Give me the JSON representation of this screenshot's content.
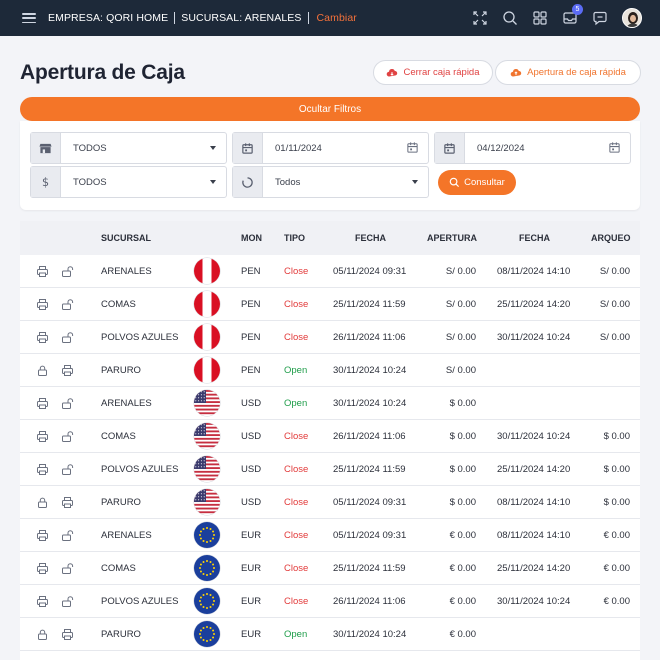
{
  "topbar": {
    "empresa": "EMPRESA: QORI HOME",
    "sucursal": "SUCURSAL: ARENALES",
    "cambiar": "Cambiar",
    "notification_count": "5"
  },
  "header": {
    "title": "Apertura de Caja",
    "close_btn": "Cerrar caja rápida",
    "open_btn": "Apertura de caja rápida"
  },
  "filters": {
    "toggle_label": "Ocultar Filtros",
    "store": "TODOS",
    "date_from": "01/11/2024",
    "date_to": "04/12/2024",
    "currency": "TODOS",
    "status": "Todos",
    "consultar": "Consultar"
  },
  "table": {
    "headers": [
      "SUCURSAL",
      "MON",
      "TIPO",
      "FECHA",
      "APERTURA",
      "FECHA",
      "ARQUEO"
    ],
    "rows": [
      {
        "lock": "open",
        "sucursal": "ARENALES",
        "flag": "pe",
        "mon": "PEN",
        "tipo": "Close",
        "fecha": "05/11/2024 09:31",
        "apertura": "S/ 0.00",
        "fecha2": "08/11/2024 14:10",
        "arqueo": "S/ 0.00"
      },
      {
        "lock": "open",
        "sucursal": "COMAS",
        "flag": "pe",
        "mon": "PEN",
        "tipo": "Close",
        "fecha": "25/11/2024 11:59",
        "apertura": "S/ 0.00",
        "fecha2": "25/11/2024 14:20",
        "arqueo": "S/ 0.00"
      },
      {
        "lock": "open",
        "sucursal": "POLVOS AZULES",
        "flag": "pe",
        "mon": "PEN",
        "tipo": "Close",
        "fecha": "26/11/2024 11:06",
        "apertura": "S/ 0.00",
        "fecha2": "30/11/2024 10:24",
        "arqueo": "S/ 0.00"
      },
      {
        "lock": "closed",
        "sucursal": "PARURO",
        "flag": "pe",
        "mon": "PEN",
        "tipo": "Open",
        "fecha": "30/11/2024 10:24",
        "apertura": "S/ 0.00",
        "fecha2": "",
        "arqueo": ""
      },
      {
        "lock": "open",
        "sucursal": "ARENALES",
        "flag": "us",
        "mon": "USD",
        "tipo": "Open",
        "fecha": "30/11/2024 10:24",
        "apertura": "$ 0.00",
        "fecha2": "",
        "arqueo": ""
      },
      {
        "lock": "open",
        "sucursal": "COMAS",
        "flag": "us",
        "mon": "USD",
        "tipo": "Close",
        "fecha": "26/11/2024 11:06",
        "apertura": "$ 0.00",
        "fecha2": "30/11/2024 10:24",
        "arqueo": "$ 0.00"
      },
      {
        "lock": "open",
        "sucursal": "POLVOS AZULES",
        "flag": "us",
        "mon": "USD",
        "tipo": "Close",
        "fecha": "25/11/2024 11:59",
        "apertura": "$ 0.00",
        "fecha2": "25/11/2024 14:20",
        "arqueo": "$ 0.00"
      },
      {
        "lock": "closed",
        "sucursal": "PARURO",
        "flag": "us",
        "mon": "USD",
        "tipo": "Close",
        "fecha": "05/11/2024 09:31",
        "apertura": "$ 0.00",
        "fecha2": "08/11/2024 14:10",
        "arqueo": "$ 0.00"
      },
      {
        "lock": "open",
        "sucursal": "ARENALES",
        "flag": "eu",
        "mon": "EUR",
        "tipo": "Close",
        "fecha": "05/11/2024 09:31",
        "apertura": "€ 0.00",
        "fecha2": "08/11/2024 14:10",
        "arqueo": "€ 0.00"
      },
      {
        "lock": "open",
        "sucursal": "COMAS",
        "flag": "eu",
        "mon": "EUR",
        "tipo": "Close",
        "fecha": "25/11/2024 11:59",
        "apertura": "€ 0.00",
        "fecha2": "25/11/2024 14:20",
        "arqueo": "€ 0.00"
      },
      {
        "lock": "open",
        "sucursal": "POLVOS AZULES",
        "flag": "eu",
        "mon": "EUR",
        "tipo": "Close",
        "fecha": "26/11/2024 11:06",
        "apertura": "€ 0.00",
        "fecha2": "30/11/2024 10:24",
        "arqueo": "€ 0.00"
      },
      {
        "lock": "closed",
        "sucursal": "PARURO",
        "flag": "eu",
        "mon": "EUR",
        "tipo": "Open",
        "fecha": "30/11/2024 10:24",
        "apertura": "€ 0.00",
        "fecha2": "",
        "arqueo": ""
      }
    ]
  },
  "colors": {
    "accent": "#f47528",
    "topbar": "#1d2939",
    "close": "#e23b3b",
    "open": "#1f9d4a"
  }
}
